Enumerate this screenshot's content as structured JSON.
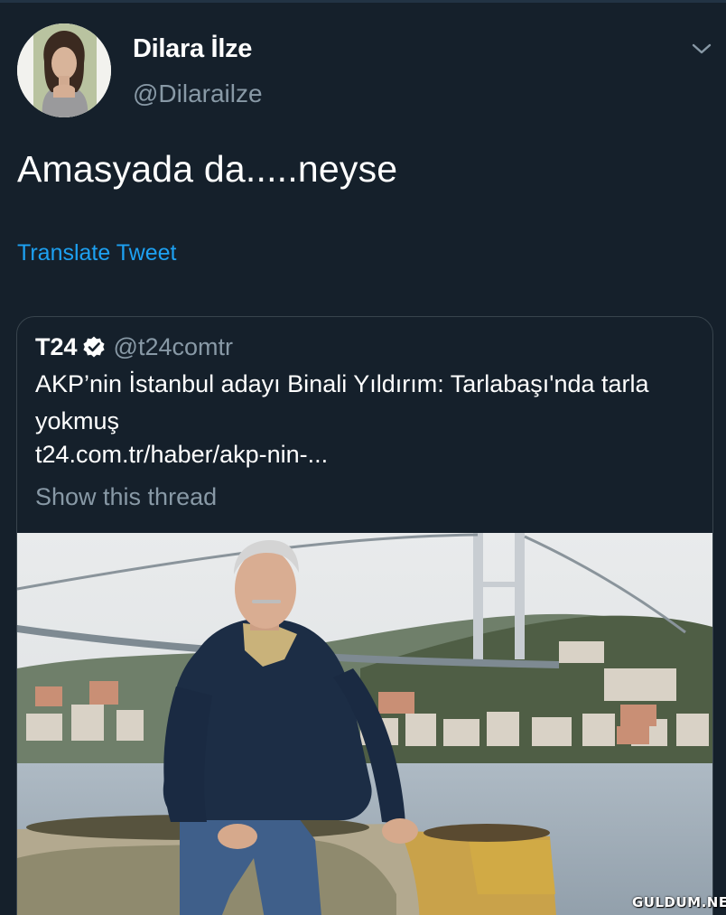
{
  "tweet": {
    "author": {
      "display_name": "Dilara İlze",
      "handle": "@Dilarailze"
    },
    "text": "Amasyada da.....neyse",
    "translate_label": "Translate Tweet",
    "menu_icon": "chevron-down-icon"
  },
  "quoted_tweet": {
    "author_name": "T24",
    "verified_icon": "verified-badge-icon",
    "handle": "@t24comtr",
    "text": "AKP’nin İstanbul adayı Binali Yıldırım: Tarlabaşı'nda tarla yokmuş",
    "link": "t24.com.tr/haber/akp-nin-...",
    "show_thread_label": "Show this thread"
  },
  "watermark": "GULDUM.NET",
  "colors": {
    "background": "#15202b",
    "text_primary": "#ffffff",
    "text_secondary": "#8899a6",
    "accent": "#1da1f2",
    "border": "#38444d"
  }
}
